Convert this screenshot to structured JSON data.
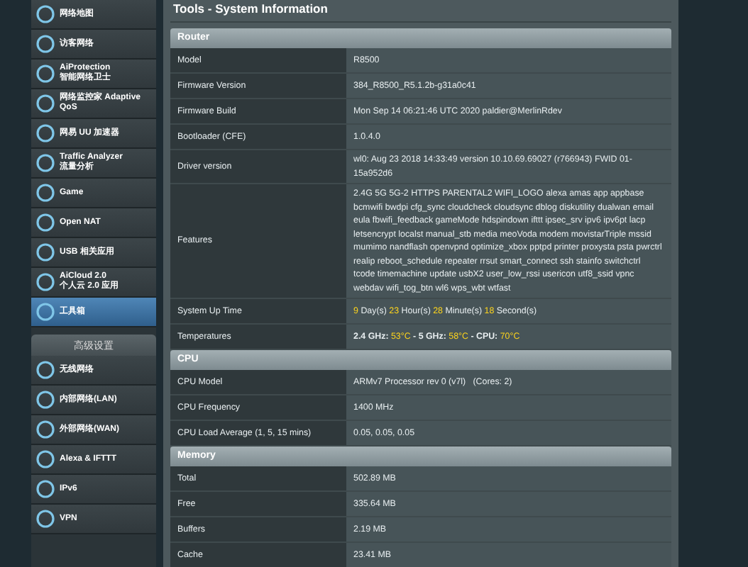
{
  "sidebar": {
    "items": [
      {
        "label": "网络地图",
        "selected": false
      },
      {
        "label": "访客网络",
        "selected": false
      },
      {
        "label": "AiProtection",
        "sublabel": "智能网络卫士",
        "selected": false
      },
      {
        "label": "网络监控家 Adaptive",
        "sublabel": "QoS",
        "selected": false
      },
      {
        "label": "网易 UU 加速器",
        "selected": false
      },
      {
        "label": "Traffic Analyzer",
        "sublabel": "流量分析",
        "selected": false
      },
      {
        "label": "Game",
        "selected": false
      },
      {
        "label": "Open NAT",
        "selected": false
      },
      {
        "label": "USB 相关应用",
        "selected": false
      },
      {
        "label": "AiCloud 2.0",
        "sublabel": "个人云 2.0 应用",
        "selected": false
      },
      {
        "label": "工具箱",
        "selected": true
      }
    ],
    "section_header": "高级设置",
    "advanced_items": [
      {
        "label": "无线网络",
        "selected": false
      },
      {
        "label": "内部网络(LAN)",
        "selected": false
      },
      {
        "label": "外部网络(WAN)",
        "selected": false
      },
      {
        "label": "Alexa & IFTTT",
        "selected": false
      },
      {
        "label": "IPv6",
        "selected": false
      },
      {
        "label": "VPN",
        "selected": false
      }
    ]
  },
  "page_title": "Tools - System Information",
  "sections": [
    {
      "title": "Router",
      "rows": [
        {
          "kind": "text",
          "label": "Model",
          "value": "R8500"
        },
        {
          "kind": "text",
          "label": "Firmware Version",
          "value": "384_R8500_R5.1.2b-g31a0c41"
        },
        {
          "kind": "text",
          "label": "Firmware Build",
          "value": "Mon Sep 14 06:21:46 UTC 2020 paldier@MerlinRdev"
        },
        {
          "kind": "text",
          "label": "Bootloader (CFE)",
          "value": "1.0.4.0"
        },
        {
          "kind": "text",
          "label": "Driver version",
          "value": "wl0: Aug 23 2018 14:33:49 version 10.10.69.69027 (r766943) FWID 01-15a952d6"
        },
        {
          "kind": "text",
          "label": "Features",
          "value": "2.4G 5G 5G-2 HTTPS PARENTAL2 WIFI_LOGO alexa amas app appbase bcmwifi bwdpi cfg_sync cloudcheck cloudsync dblog diskutility dualwan email eula fbwifi_feedback gameMode hdspindown ifttt ipsec_srv ipv6 ipv6pt lacp letsencrypt localst manual_stb media meoVoda modem movistarTriple mssid mumimo nandflash openvpnd optimize_xbox pptpd printer proxysta psta pwrctrl realip reboot_schedule repeater rrsut smart_connect ssh stainfo switchctrl tcode timemachine update usbX2 user_low_rssi usericon utf8_ssid vpnc webdav wifi_tog_btn wl6 wps_wbt wtfast"
        },
        {
          "kind": "uptime",
          "label": "System Up Time",
          "parts": [
            {
              "value": "9",
              "unit": "Day(s)"
            },
            {
              "value": "23",
              "unit": "Hour(s)"
            },
            {
              "value": "28",
              "unit": "Minute(s)"
            },
            {
              "value": "18",
              "unit": "Second(s)"
            }
          ]
        },
        {
          "kind": "temps",
          "label": "Temperatures",
          "separator": "-",
          "parts": [
            {
              "name": "2.4 GHz:",
              "value": "53°C"
            },
            {
              "name": "5 GHz:",
              "value": "58°C"
            },
            {
              "name": "CPU:",
              "value": "70°C"
            }
          ]
        }
      ]
    },
    {
      "title": "CPU",
      "rows": [
        {
          "kind": "text",
          "label": "CPU Model",
          "value": "ARMv7 Processor rev 0 (v7l)   (Cores: 2)"
        },
        {
          "kind": "text",
          "label": "CPU Frequency",
          "value": "1400 MHz"
        },
        {
          "kind": "text",
          "label": "CPU Load Average (1, 5, 15 mins)",
          "value": "0.05, 0.05, 0.05"
        }
      ]
    },
    {
      "title": "Memory",
      "rows": [
        {
          "kind": "text",
          "label": "Total",
          "value": "502.89 MB"
        },
        {
          "kind": "text",
          "label": "Free",
          "value": "335.64 MB"
        },
        {
          "kind": "text",
          "label": "Buffers",
          "value": "2.19 MB"
        },
        {
          "kind": "text",
          "label": "Cache",
          "value": "23.41 MB"
        }
      ]
    }
  ]
}
